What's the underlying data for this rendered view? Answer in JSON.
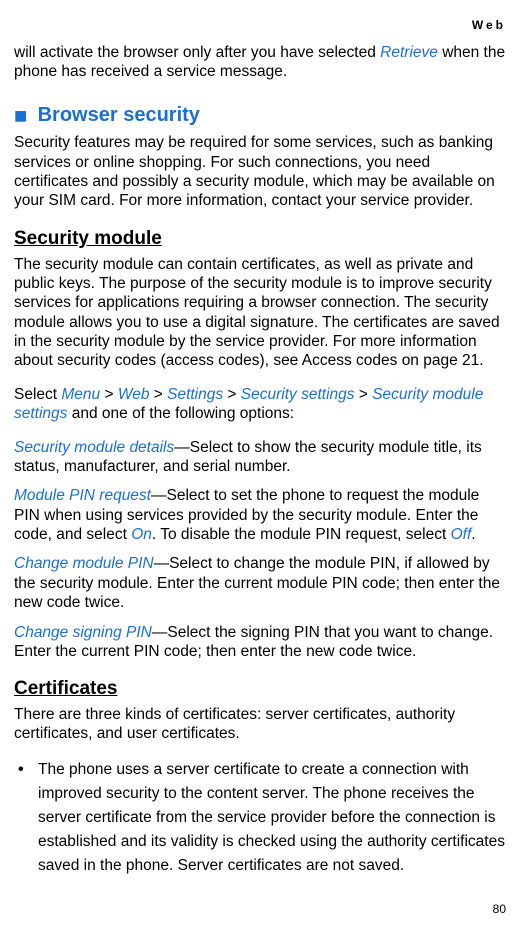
{
  "header": "Web",
  "intro": {
    "pre": "will activate the browser only after you have selected ",
    "retrieve": "Retrieve",
    "post": " when the phone has received a service message."
  },
  "section": {
    "marker": "■",
    "title": "Browser security",
    "para": "Security features may be required for some services, such as banking services or online shopping. For such connections, you need certificates and possibly a security module, which may be available on your SIM card. For more information, contact your service provider."
  },
  "security_module": {
    "title": "Security module",
    "para": "The security module can contain certificates, as well as private and public keys. The purpose of the security module is to improve security services for applications requiring a browser connection. The security module allows you to use a digital signature. The certificates are saved in the security module by the service provider. For more information about security codes (access codes), see Access codes on page 21.",
    "path_pre": "Select ",
    "menu": "Menu",
    "gt": " > ",
    "web": "Web",
    "settings": "Settings",
    "sec_settings": "Security settings",
    "sec_module_settings": "Security module settings",
    "path_post": " and one of the following options:",
    "options": [
      {
        "label": "Security module details",
        "desc": "—Select to show the security module title, its status, manufacturer, and serial number."
      },
      {
        "label": "Module PIN request",
        "desc_pre": "—Select to set the phone to request the module PIN when using services provided by the security module. Enter the code, and select ",
        "on": "On",
        "desc_mid": ". To disable the module PIN request, select ",
        "off": "Off",
        "desc_post": "."
      },
      {
        "label": "Change module PIN",
        "desc": "—Select to change the module PIN, if allowed by the security module. Enter the current module PIN code; then enter the new code twice."
      },
      {
        "label": "Change signing PIN",
        "desc": "—Select the signing PIN that you want to change. Enter the current PIN code; then enter the new code twice."
      }
    ]
  },
  "certificates": {
    "title": "Certificates",
    "para": "There are three kinds of certificates: server certificates, authority certificates, and user certificates.",
    "bullet1": "The phone uses a server certificate to create a connection with improved security to the content server. The phone receives the server certificate from the service provider before the connection is established and its validity is checked using the authority certificates saved in the phone. Server certificates are not saved."
  },
  "page_number": "80"
}
